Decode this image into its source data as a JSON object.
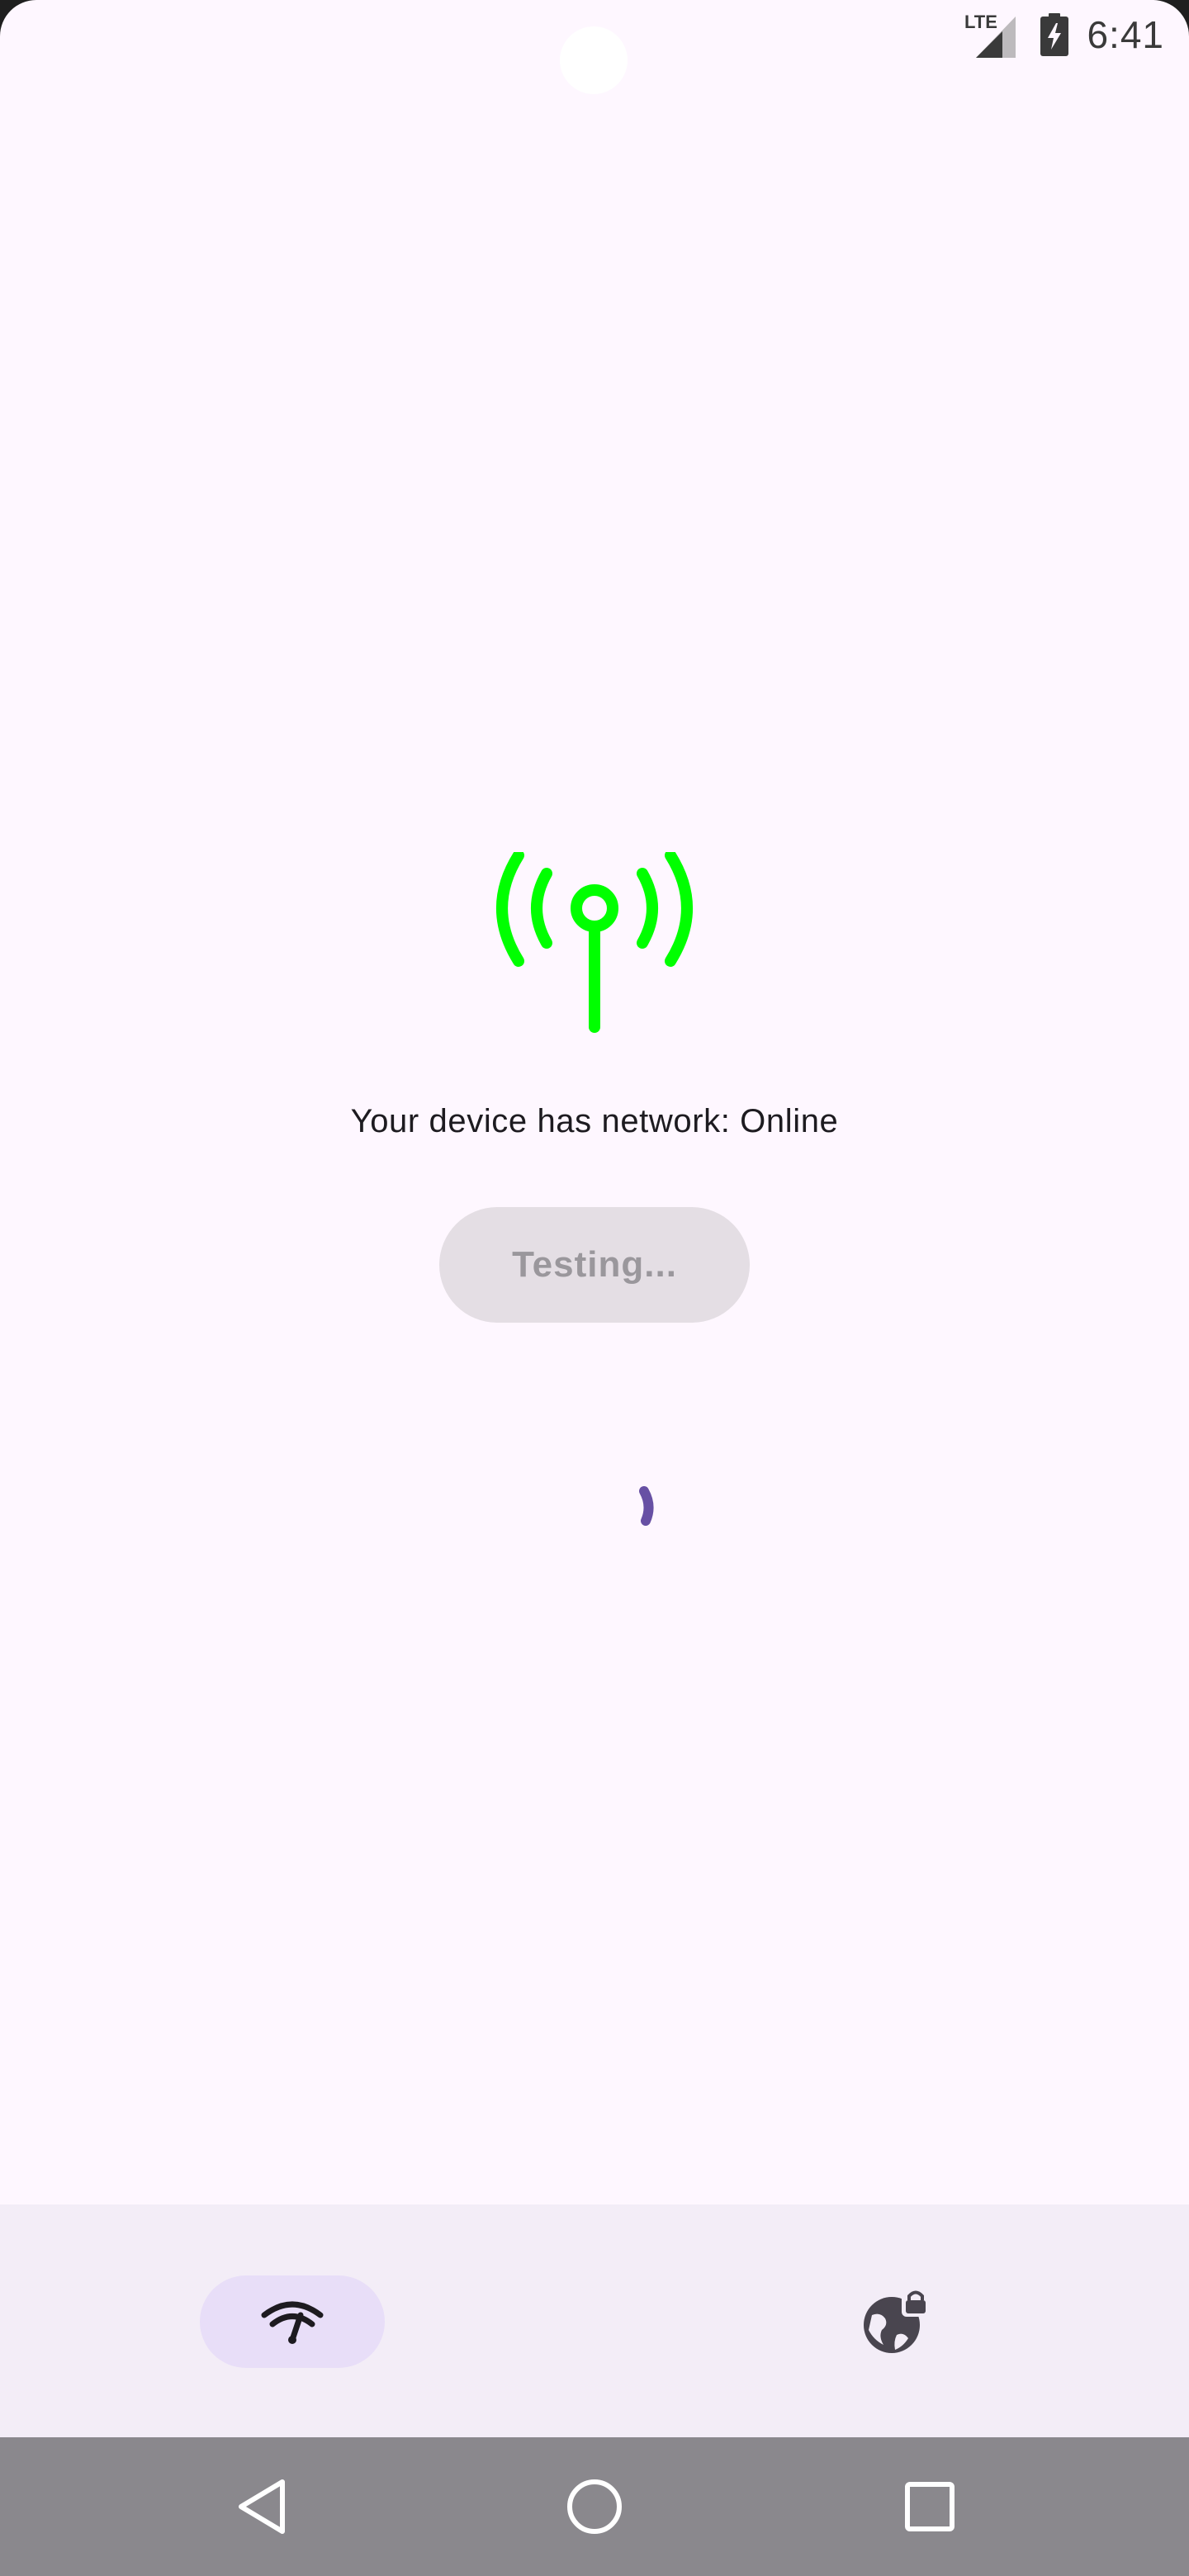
{
  "status_bar": {
    "network_label": "LTE",
    "time": "6:41",
    "icons": [
      "lte-signal-icon",
      "battery-charging-icon"
    ]
  },
  "main": {
    "status_icon": "cell-tower-icon",
    "status_icon_color": "#00FF00",
    "network_status_text": "Your device has network: Online",
    "test_button_label": "Testing...",
    "spinner_color": "#6750A4"
  },
  "bottom_nav": {
    "items": [
      {
        "icon": "speed-test-icon",
        "selected": true
      },
      {
        "icon": "vpn-globe-lock-icon",
        "selected": false
      }
    ]
  },
  "system_nav": {
    "buttons": [
      "back-icon",
      "home-icon",
      "recents-icon"
    ]
  },
  "colors": {
    "background": "#FEF7FF",
    "nav_background": "#F3EDF7",
    "nav_indicator": "#E8DEF8",
    "system_bar": "#8A888D"
  }
}
